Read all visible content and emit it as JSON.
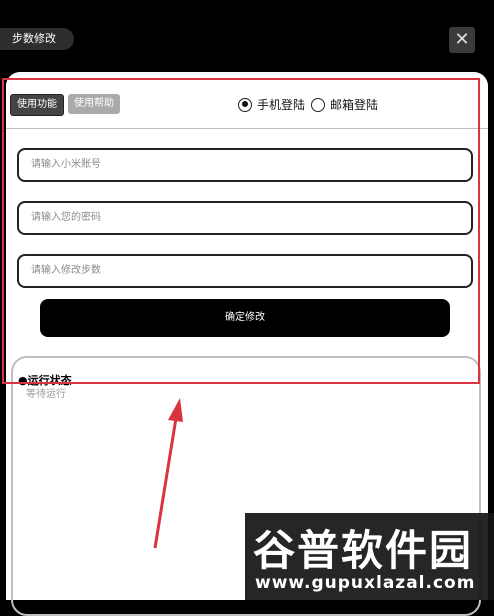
{
  "window": {
    "title": "步数修改",
    "close_glyph": "✕"
  },
  "tabs": {
    "active_label": "使用功能",
    "inactive_label": "使用帮助"
  },
  "login_mode": {
    "options": [
      {
        "label": "手机登陆",
        "selected": true
      },
      {
        "label": "邮箱登陆",
        "selected": false
      }
    ]
  },
  "form": {
    "account_placeholder": "请输入小米账号",
    "password_placeholder": "请输入您的密码",
    "steps_placeholder": "请输入修改步数",
    "confirm_label": "确定修改"
  },
  "status": {
    "title": "●运行状态",
    "text": "等待运行"
  },
  "watermark": {
    "title": "谷普软件园",
    "url": "www.gupuxlazal.com"
  },
  "colors": {
    "annotation": "#d9343f",
    "button_dark": "#000000",
    "panel_bg": "#ffffff"
  }
}
